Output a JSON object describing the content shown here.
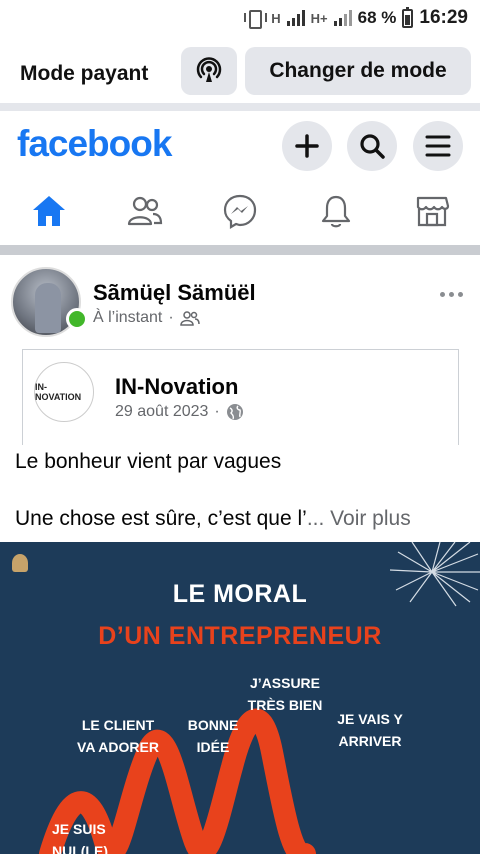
{
  "status_bar": {
    "network_1": "H",
    "network_2": "H+",
    "battery": "68 %",
    "time": "16:29"
  },
  "mode_bar": {
    "label": "Mode payant",
    "button_label": "Changer de mode",
    "icon": "broadcast-icon"
  },
  "header": {
    "logo": "facebook",
    "actions": [
      "plus-icon",
      "search-icon",
      "menu-icon"
    ]
  },
  "tabs": [
    {
      "name": "home",
      "icon": "home-icon",
      "active": true
    },
    {
      "name": "friends",
      "icon": "friends-icon",
      "active": false
    },
    {
      "name": "messenger",
      "icon": "messenger-icon",
      "active": false
    },
    {
      "name": "notifications",
      "icon": "bell-icon",
      "active": false
    },
    {
      "name": "marketplace",
      "icon": "marketplace-icon",
      "active": false
    }
  ],
  "post": {
    "author": "Sãmüęl Sämüël",
    "time": "À l’instant",
    "audience_icon": "friends-icon",
    "shared": {
      "page_name": "IN-Novation",
      "avatar_text": "IN-NOVATION",
      "date": "29 août 2023",
      "audience_icon": "globe-icon"
    },
    "text_line_1": "Le bonheur vient par vagues",
    "text_line_2": "Une chose est sûre, c’est que l’",
    "see_more": "... Voir plus",
    "image": {
      "title": "LE MORAL",
      "subtitle": "D’UN ENTREPRENEUR",
      "labels": {
        "client": "LE CLIENT\nVA ADORER",
        "bonne": "BONNE\nIDÉE",
        "assure": "J’ASSURE\nTRÈS BIEN",
        "vais": "JE VAIS Y\nARRIVER",
        "suis": "JE SUIS\nNUL(LE)"
      }
    }
  },
  "colors": {
    "brand": "#1877f2",
    "online": "#42b72a",
    "image_bg": "#1d3b59",
    "image_accent": "#e8421c"
  }
}
